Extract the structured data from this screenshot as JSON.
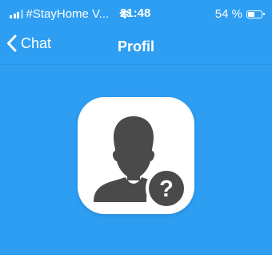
{
  "status_bar": {
    "carrier": "#StayHome V...",
    "time": "21:48",
    "battery_percent": "54 %",
    "battery_level": 0.54,
    "signal_bars": 4,
    "signal_active": 3
  },
  "nav": {
    "back_label": "Chat",
    "title": "Profil"
  },
  "avatar": {
    "icon": "unknown-person-icon",
    "badge_symbol": "?"
  },
  "colors": {
    "background": "#2e9ef2",
    "avatar_card": "#ffffff",
    "silhouette": "#4a4a4a"
  }
}
